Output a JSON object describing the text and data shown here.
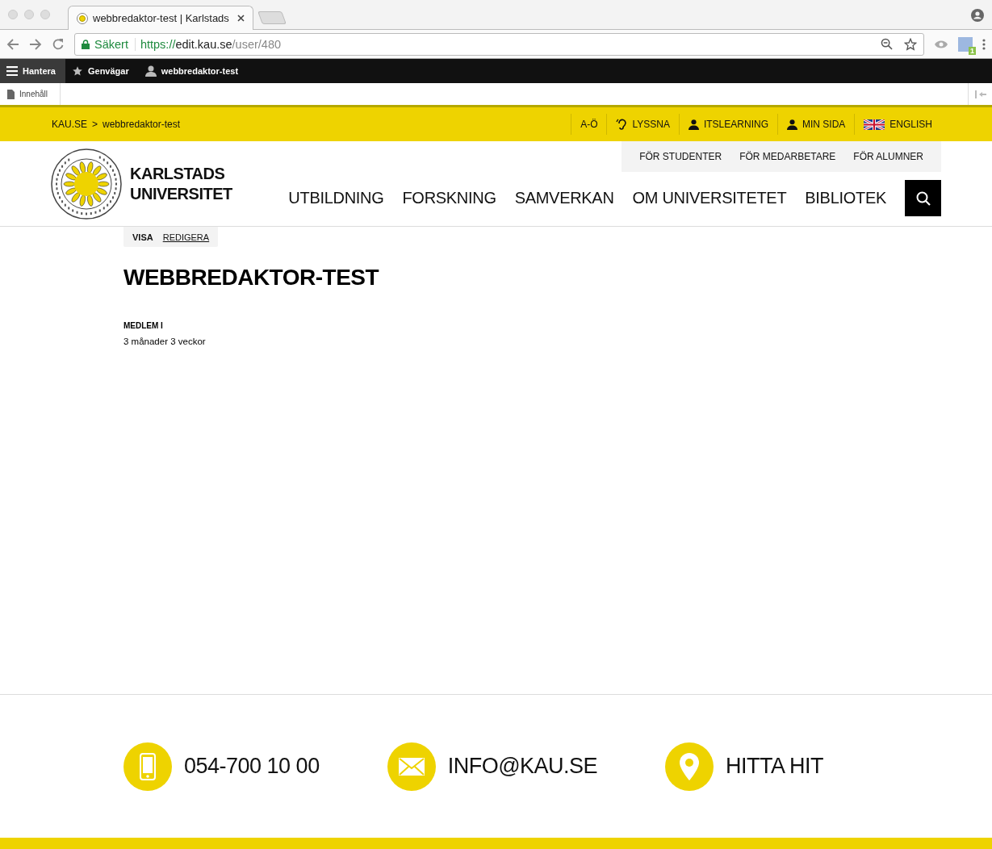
{
  "browser": {
    "tab_title": "webbredaktor-test | Karlstads",
    "secure_label": "Säkert",
    "url": {
      "scheme": "https://",
      "host": "edit.kau.se",
      "path": "/user/480"
    },
    "extension_badge": "1"
  },
  "admin_toolbar": {
    "items": [
      {
        "label": "Hantera",
        "kind": "menu",
        "selected": true
      },
      {
        "label": "Genvägar",
        "kind": "star",
        "selected": false
      },
      {
        "label": "webbredaktor-test",
        "kind": "user",
        "selected": false
      }
    ]
  },
  "admin_tray": {
    "items": [
      {
        "label": "Innehåll"
      }
    ]
  },
  "breadcrumb": [
    {
      "label": "KAU.SE"
    },
    {
      "label": "webbredaktor-test"
    }
  ],
  "breadcrumb_separator": ">",
  "top_links": [
    {
      "label": "A-Ö",
      "kind": "text"
    },
    {
      "label": "LYSSNA",
      "kind": "ear"
    },
    {
      "label": "ITSLEARNING",
      "kind": "person"
    },
    {
      "label": "MIN SIDA",
      "kind": "person"
    },
    {
      "label": "ENGLISH",
      "kind": "flag"
    }
  ],
  "logo": {
    "line1": "KARLSTADS",
    "line2": "UNIVERSITET"
  },
  "audience_links": [
    "FÖR STUDENTER",
    "FÖR MEDARBETARE",
    "FÖR ALUMNER"
  ],
  "main_nav": [
    "UTBILDNING",
    "FORSKNING",
    "SAMVERKAN",
    "OM UNIVERSITETET",
    "BIBLIOTEK"
  ],
  "page_tabs": [
    {
      "label": "VISA",
      "selected": true
    },
    {
      "label": "REDIGERA",
      "selected": false
    }
  ],
  "page_title": "WEBBREDAKTOR-TEST",
  "fields": [
    {
      "label": "MEDLEM I",
      "value": "3 månader 3 veckor"
    }
  ],
  "contacts": [
    {
      "label": "054-700 10 00",
      "kind": "phone"
    },
    {
      "label": "INFO@KAU.SE",
      "kind": "mail"
    },
    {
      "label": "HITTA HIT",
      "kind": "pin"
    }
  ]
}
